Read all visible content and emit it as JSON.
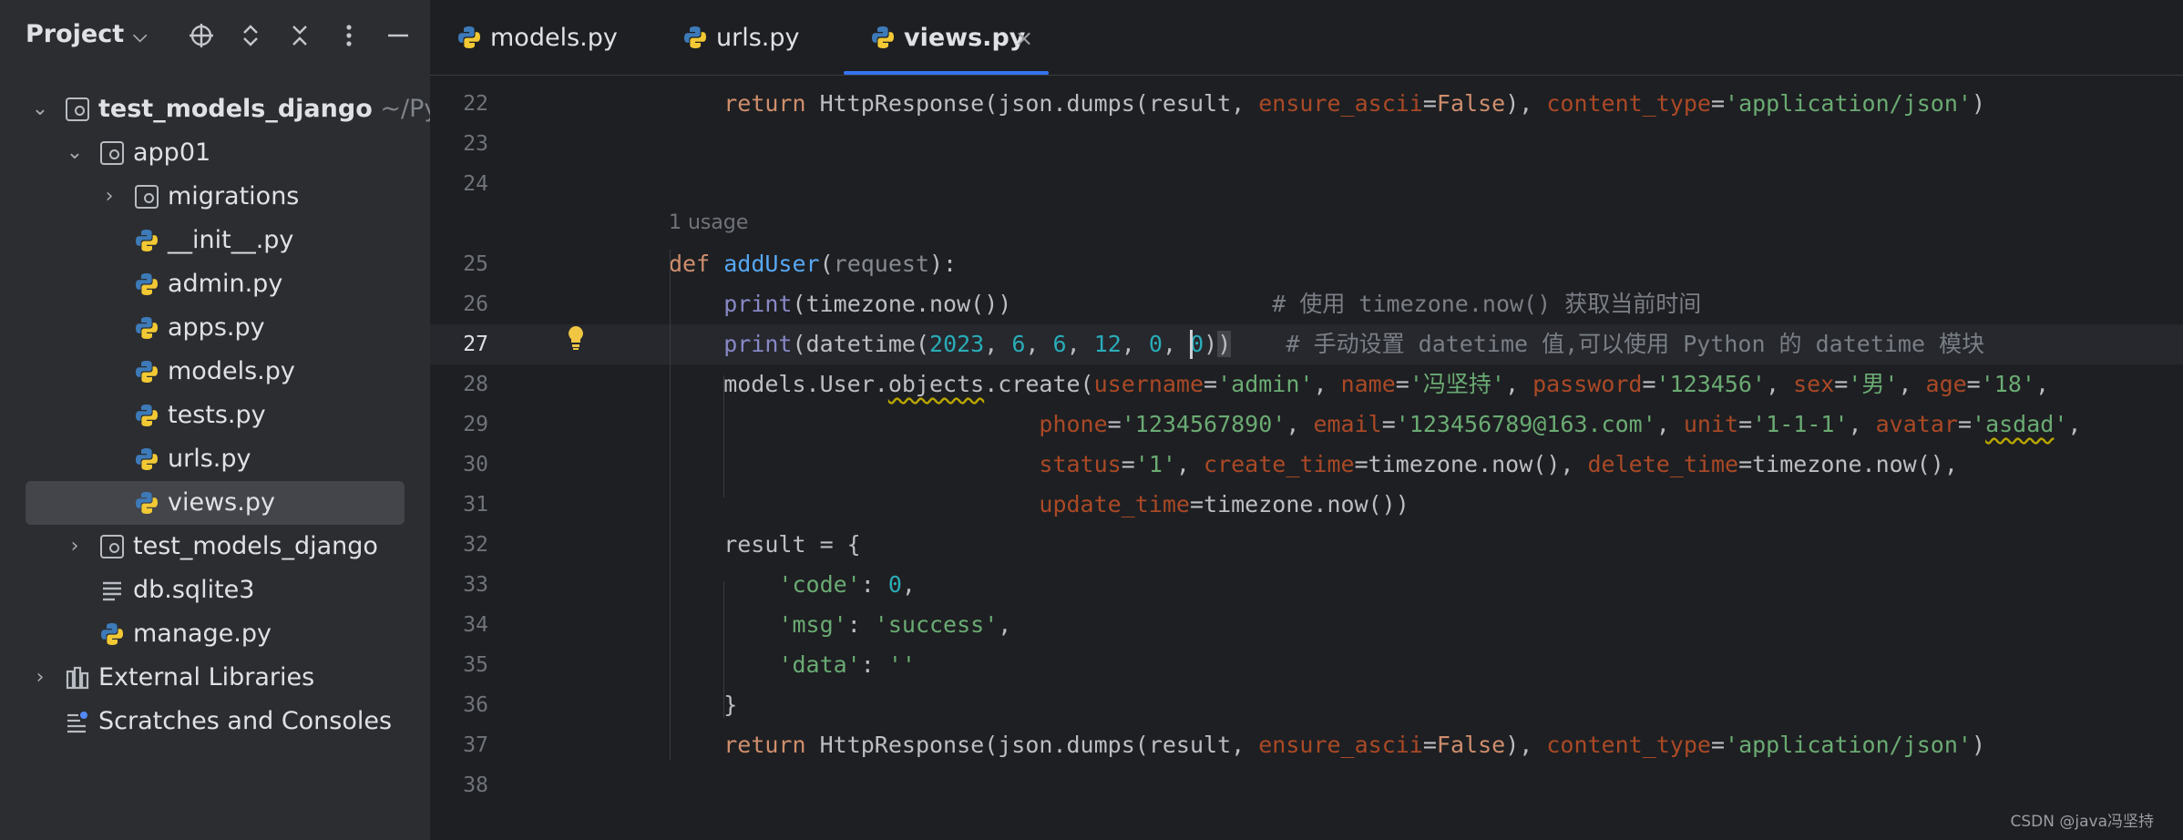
{
  "sidebar": {
    "title": "Project",
    "tree": [
      {
        "label": "test_models_django",
        "suffix": "~/Pycha",
        "kind": "folder",
        "expanded": true,
        "depth": 0
      },
      {
        "label": "app01",
        "kind": "package",
        "expanded": true,
        "depth": 1
      },
      {
        "label": "migrations",
        "kind": "package",
        "expanded": false,
        "depth": 2
      },
      {
        "label": "__init__.py",
        "kind": "python",
        "depth": 2
      },
      {
        "label": "admin.py",
        "kind": "python",
        "depth": 2
      },
      {
        "label": "apps.py",
        "kind": "python",
        "depth": 2
      },
      {
        "label": "models.py",
        "kind": "python",
        "depth": 2
      },
      {
        "label": "tests.py",
        "kind": "python",
        "depth": 2
      },
      {
        "label": "urls.py",
        "kind": "python",
        "depth": 2
      },
      {
        "label": "views.py",
        "kind": "python",
        "depth": 2,
        "selected": true
      },
      {
        "label": "test_models_django",
        "kind": "package",
        "expanded": false,
        "depth": 1
      },
      {
        "label": "db.sqlite3",
        "kind": "text",
        "depth": 1
      },
      {
        "label": "manage.py",
        "kind": "python",
        "depth": 1
      },
      {
        "label": "External Libraries",
        "kind": "library",
        "expanded": false,
        "depth": 0
      },
      {
        "label": "Scratches and Consoles",
        "kind": "scratch",
        "depth": 0
      }
    ]
  },
  "tabs": [
    {
      "label": "models.py",
      "active": false
    },
    {
      "label": "urls.py",
      "active": false
    },
    {
      "label": "views.py",
      "active": true,
      "close": "×"
    }
  ],
  "editor": {
    "inlay_usage": "1 usage",
    "current_line": "27",
    "lines": [
      {
        "num": "22",
        "tokens": [
          [
            "    ",
            ""
          ],
          [
            "return",
            "kw"
          ],
          [
            " HttpResponse(json.dumps(result, ",
            ""
          ],
          [
            "ensure_ascii",
            "named"
          ],
          [
            "=",
            ""
          ],
          [
            "False",
            "kw"
          ],
          [
            "), ",
            ""
          ],
          [
            "content_type",
            "named"
          ],
          [
            "=",
            ""
          ],
          [
            "'application/json'",
            "str"
          ],
          [
            ")",
            ""
          ]
        ]
      },
      {
        "num": "23",
        "tokens": []
      },
      {
        "num": "24",
        "tokens": []
      },
      {
        "num": "25",
        "tokens": [
          [
            "def",
            "kw"
          ],
          [
            " ",
            ""
          ],
          [
            "addUser",
            "fn"
          ],
          [
            "(",
            ""
          ],
          [
            "request",
            "param"
          ],
          [
            "):",
            ""
          ]
        ]
      },
      {
        "num": "26",
        "tokens": [
          [
            "    ",
            ""
          ],
          [
            "print",
            "builtin"
          ],
          [
            "(timezone.now())                   ",
            ""
          ],
          [
            "# 使用 timezone.now() 获取当前时间",
            "cmt"
          ]
        ]
      },
      {
        "num": "27",
        "tokens": [
          [
            "    ",
            ""
          ],
          [
            "print",
            "builtin"
          ],
          [
            "(",
            ""
          ],
          [
            "datetime(",
            ""
          ],
          [
            "2023",
            "num"
          ],
          [
            ", ",
            ""
          ],
          [
            "6",
            "num"
          ],
          [
            ", ",
            ""
          ],
          [
            "6",
            "num"
          ],
          [
            ", ",
            ""
          ],
          [
            "12",
            "num"
          ],
          [
            ", ",
            ""
          ],
          [
            "0",
            "num"
          ],
          [
            ", ",
            ""
          ],
          [
            "0",
            "num"
          ],
          [
            ")",
            ""
          ],
          [
            ")",
            "paren"
          ],
          [
            "    ",
            ""
          ],
          [
            "# 手动设置 datetime 值,可以使用 Python 的 datetime 模块",
            "cmt"
          ]
        ]
      },
      {
        "num": "28",
        "tokens": [
          [
            "    models.User.",
            ""
          ],
          [
            "objects",
            "squig"
          ],
          [
            ".create(",
            ""
          ],
          [
            "username",
            "named"
          ],
          [
            "=",
            ""
          ],
          [
            "'admin'",
            "str"
          ],
          [
            ", ",
            ""
          ],
          [
            "name",
            "named"
          ],
          [
            "=",
            ""
          ],
          [
            "'冯坚持'",
            "str"
          ],
          [
            ", ",
            ""
          ],
          [
            "password",
            "named"
          ],
          [
            "=",
            ""
          ],
          [
            "'123456'",
            "str"
          ],
          [
            ", ",
            ""
          ],
          [
            "sex",
            "named"
          ],
          [
            "=",
            ""
          ],
          [
            "'男'",
            "str"
          ],
          [
            ", ",
            ""
          ],
          [
            "age",
            "named"
          ],
          [
            "=",
            ""
          ],
          [
            "'18'",
            "str"
          ],
          [
            ",",
            ""
          ]
        ]
      },
      {
        "num": "29",
        "tokens": [
          [
            "                           ",
            ""
          ],
          [
            "phone",
            "named"
          ],
          [
            "=",
            ""
          ],
          [
            "'1234567890'",
            "str"
          ],
          [
            ", ",
            ""
          ],
          [
            "email",
            "named"
          ],
          [
            "=",
            ""
          ],
          [
            "'123456789@163.com'",
            "str"
          ],
          [
            ", ",
            ""
          ],
          [
            "unit",
            "named"
          ],
          [
            "=",
            ""
          ],
          [
            "'1-1-1'",
            "str"
          ],
          [
            ", ",
            ""
          ],
          [
            "avatar",
            "named"
          ],
          [
            "=",
            ""
          ],
          [
            "'",
            "str"
          ],
          [
            "asdad",
            "strsquig"
          ],
          [
            "'",
            "str"
          ],
          [
            ",",
            ""
          ]
        ]
      },
      {
        "num": "30",
        "tokens": [
          [
            "                           ",
            ""
          ],
          [
            "status",
            "named"
          ],
          [
            "=",
            ""
          ],
          [
            "'1'",
            "str"
          ],
          [
            ", ",
            ""
          ],
          [
            "create_time",
            "named"
          ],
          [
            "=timezone.now(), ",
            ""
          ],
          [
            "delete_time",
            "named"
          ],
          [
            "=timezone.now(),",
            ""
          ]
        ]
      },
      {
        "num": "31",
        "tokens": [
          [
            "                           ",
            ""
          ],
          [
            "update_time",
            "named"
          ],
          [
            "=timezone.now())",
            ""
          ]
        ]
      },
      {
        "num": "32",
        "tokens": [
          [
            "    result = {",
            ""
          ]
        ]
      },
      {
        "num": "33",
        "tokens": [
          [
            "        ",
            ""
          ],
          [
            "'code'",
            "str"
          ],
          [
            ": ",
            ""
          ],
          [
            "0",
            "num"
          ],
          [
            ",",
            ""
          ]
        ]
      },
      {
        "num": "34",
        "tokens": [
          [
            "        ",
            ""
          ],
          [
            "'msg'",
            "str"
          ],
          [
            ": ",
            ""
          ],
          [
            "'success'",
            "str"
          ],
          [
            ",",
            ""
          ]
        ]
      },
      {
        "num": "35",
        "tokens": [
          [
            "        ",
            ""
          ],
          [
            "'data'",
            "str"
          ],
          [
            ": ",
            ""
          ],
          [
            "''",
            "str"
          ]
        ]
      },
      {
        "num": "36",
        "tokens": [
          [
            "    }",
            ""
          ]
        ]
      },
      {
        "num": "37",
        "tokens": [
          [
            "    ",
            ""
          ],
          [
            "return",
            "kw"
          ],
          [
            " HttpResponse(json.dumps(result, ",
            ""
          ],
          [
            "ensure_ascii",
            "named"
          ],
          [
            "=",
            ""
          ],
          [
            "False",
            "kw"
          ],
          [
            "), ",
            ""
          ],
          [
            "content_type",
            "named"
          ],
          [
            "=",
            ""
          ],
          [
            "'application/json'",
            "str"
          ],
          [
            ")",
            ""
          ]
        ]
      },
      {
        "num": "38",
        "tokens": []
      }
    ]
  },
  "watermark": "CSDN @java冯坚持"
}
